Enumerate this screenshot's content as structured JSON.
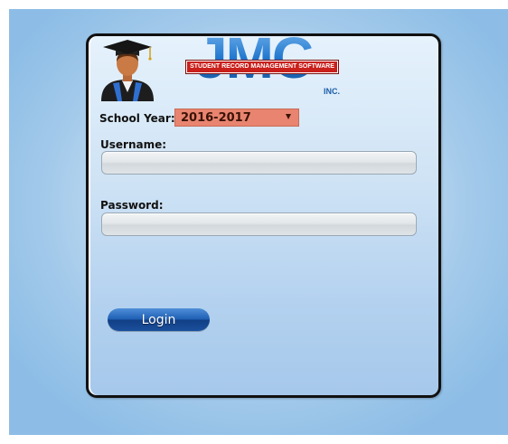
{
  "branding": {
    "logo_text": "JMC",
    "logo_banner": "STUDENT RECORD MANAGEMENT SOFTWARE",
    "logo_suffix": "INC.",
    "brand_color": "#1c6fc1",
    "banner_color": "#c9201c",
    "avatar_icon": "graduate-icon"
  },
  "school_year": {
    "label": "School Year:",
    "selected": "2016-2017",
    "background_color": "#e8846f"
  },
  "username": {
    "label": "Username:",
    "value": "",
    "placeholder": ""
  },
  "password": {
    "label": "Password:",
    "value": "",
    "placeholder": ""
  },
  "login": {
    "label": "Login"
  }
}
